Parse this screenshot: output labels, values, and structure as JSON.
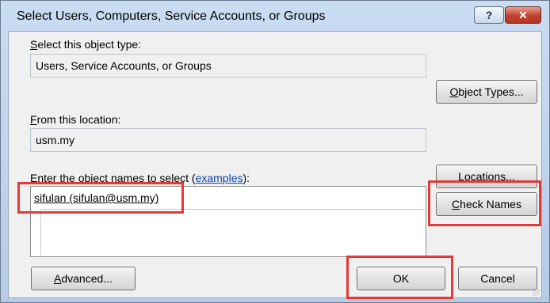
{
  "window": {
    "title": "Select Users, Computers, Service Accounts, or Groups",
    "help_label": "?",
    "close_label": "✕"
  },
  "object_type": {
    "label_first": "S",
    "label_rest": "elect this object type:",
    "value": "Users, Service Accounts, or Groups",
    "button_first": "O",
    "button_rest": "bject Types..."
  },
  "location": {
    "label_first": "F",
    "label_rest": "rom this location:",
    "value": "usm.my",
    "button_first": "L",
    "button_rest": "ocations..."
  },
  "names": {
    "label_first": "E",
    "label_rest": "nter the object names to select (",
    "link": "examples",
    "label_end": "):",
    "entry": "sifulan (sifulan@usm.my)",
    "check_first": "C",
    "check_rest": "heck Names"
  },
  "footer": {
    "advanced_first": "A",
    "advanced_rest": "dvanced...",
    "ok_label": "OK",
    "cancel_label": "Cancel"
  },
  "colors": {
    "highlight": "#e53935",
    "title_bar": "#c9dcf2",
    "client_bg": "#f0f0f0"
  }
}
